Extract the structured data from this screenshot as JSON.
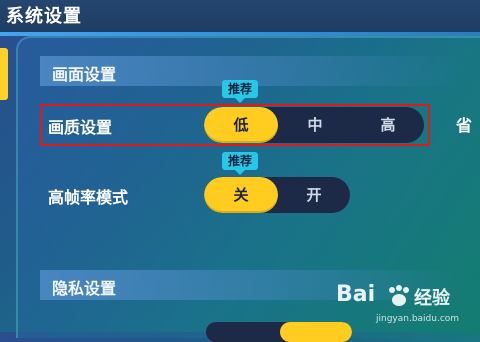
{
  "header": {
    "title": "系统设置"
  },
  "sections": [
    {
      "label": "画面设置"
    },
    {
      "label": "隐私设置"
    }
  ],
  "graphics_quality": {
    "label": "画质设置",
    "badge": "推荐",
    "options": [
      "低",
      "中",
      "高"
    ],
    "selected": "低"
  },
  "high_fps": {
    "label": "高帧率模式",
    "badge": "推荐",
    "options": [
      "关",
      "开"
    ],
    "selected": "关"
  },
  "side_partial_label": "省",
  "watermark": {
    "brand": "Bai",
    "brand2": "经验",
    "url": "jingyan.baidu.com"
  },
  "colors": {
    "accent": "#ffcc1f",
    "segment_bg": "#1c2a48",
    "badge": "#28c7e6",
    "highlight_border": "#e01a1a"
  }
}
